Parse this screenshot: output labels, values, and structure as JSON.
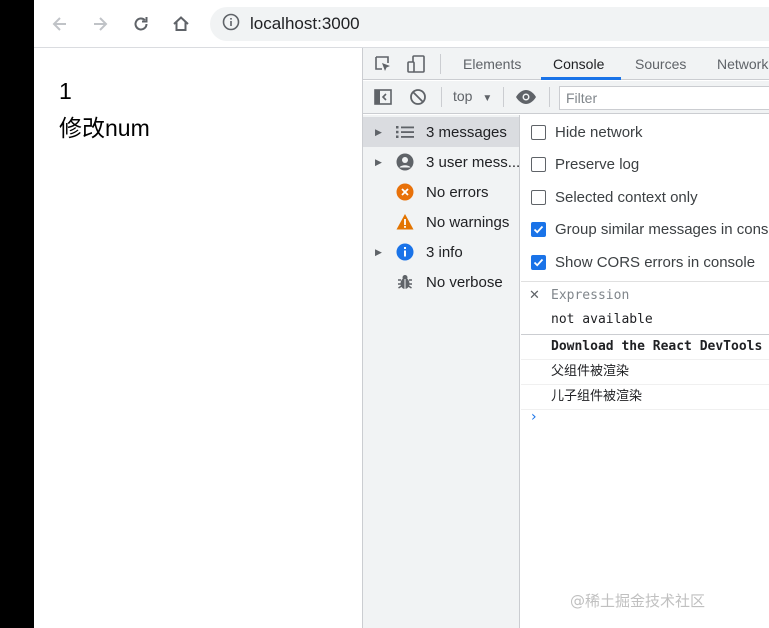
{
  "browser": {
    "url": "localhost:3000"
  },
  "page": {
    "num": "1",
    "modify_button": "修改num"
  },
  "devtools": {
    "tabs": [
      "Elements",
      "Console",
      "Sources",
      "Network"
    ],
    "active_tab": "Console",
    "context": "top",
    "filter_placeholder": "Filter",
    "sidebar": [
      {
        "label": "3 messages",
        "icon": "list-icon",
        "expandable": true
      },
      {
        "label": "3 user mess...",
        "icon": "user-icon",
        "expandable": true
      },
      {
        "label": "No errors",
        "icon": "error-icon",
        "expandable": false
      },
      {
        "label": "No warnings",
        "icon": "warning-icon",
        "expandable": false
      },
      {
        "label": "3 info",
        "icon": "info-icon",
        "expandable": true
      },
      {
        "label": "No verbose",
        "icon": "bug-icon",
        "expandable": false
      }
    ],
    "settings": [
      {
        "label": "Hide network",
        "checked": false
      },
      {
        "label": "Preserve log",
        "checked": false
      },
      {
        "label": "Selected context only",
        "checked": false
      },
      {
        "label": "Group similar messages in console",
        "checked": true
      },
      {
        "label": "Show CORS errors in console",
        "checked": true
      }
    ],
    "expression": {
      "label": "Expression",
      "value": "not available"
    },
    "logs": [
      "Download the React DevTools",
      "父组件被渲染",
      "儿子组件被渲染"
    ]
  },
  "watermark": "@稀土掘金技术社区",
  "colors": {
    "accent": "#1a73e8",
    "error": "#e8710a",
    "warning": "#e37400",
    "info": "#1a73e8"
  }
}
